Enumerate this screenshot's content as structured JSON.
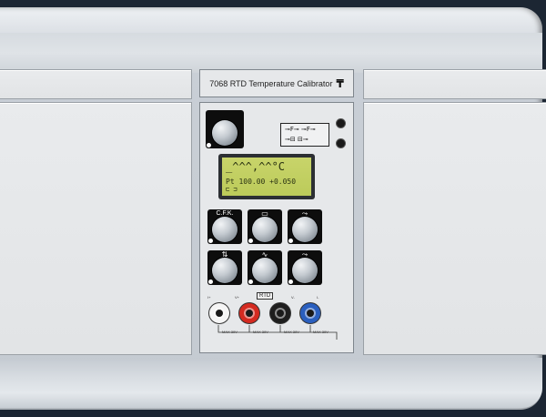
{
  "instrument": {
    "title": "7068 RTD Temperature Calibrator",
    "logo_glyph": "₸"
  },
  "display": {
    "line1": "_^^^,^^°C",
    "line2": "Pt 100.00 +0.050",
    "line3": "⊏   ⊐"
  },
  "mode_panel": {
    "row1": "⊸F⊸ ⊸F⊸",
    "row2": "⊸⊟ ⊟⊸"
  },
  "knobs": [
    {
      "label": "C.F.K.",
      "glyph": ""
    },
    {
      "label": "",
      "glyph": "▭"
    },
    {
      "label": "",
      "glyph": "⤳"
    },
    {
      "label": "",
      "glyph": "⇅"
    },
    {
      "label": "",
      "glyph": "∿"
    },
    {
      "label": "",
      "glyph": "⤳"
    }
  ],
  "jacks": {
    "group_label": "RTD",
    "labels": [
      "I+",
      "V+",
      "V-",
      "I-"
    ],
    "limits": [
      "MAX 30V",
      "MAX 30V",
      "MAX 30V",
      "MAX 30V"
    ],
    "colors": [
      "#f5f5f5",
      "#d42a20",
      "#1e1e1e",
      "#2a5fbf"
    ]
  },
  "colors": {
    "background": "#1c2633",
    "lcd": "#c4cf62",
    "panel": "#e6e8ea"
  }
}
